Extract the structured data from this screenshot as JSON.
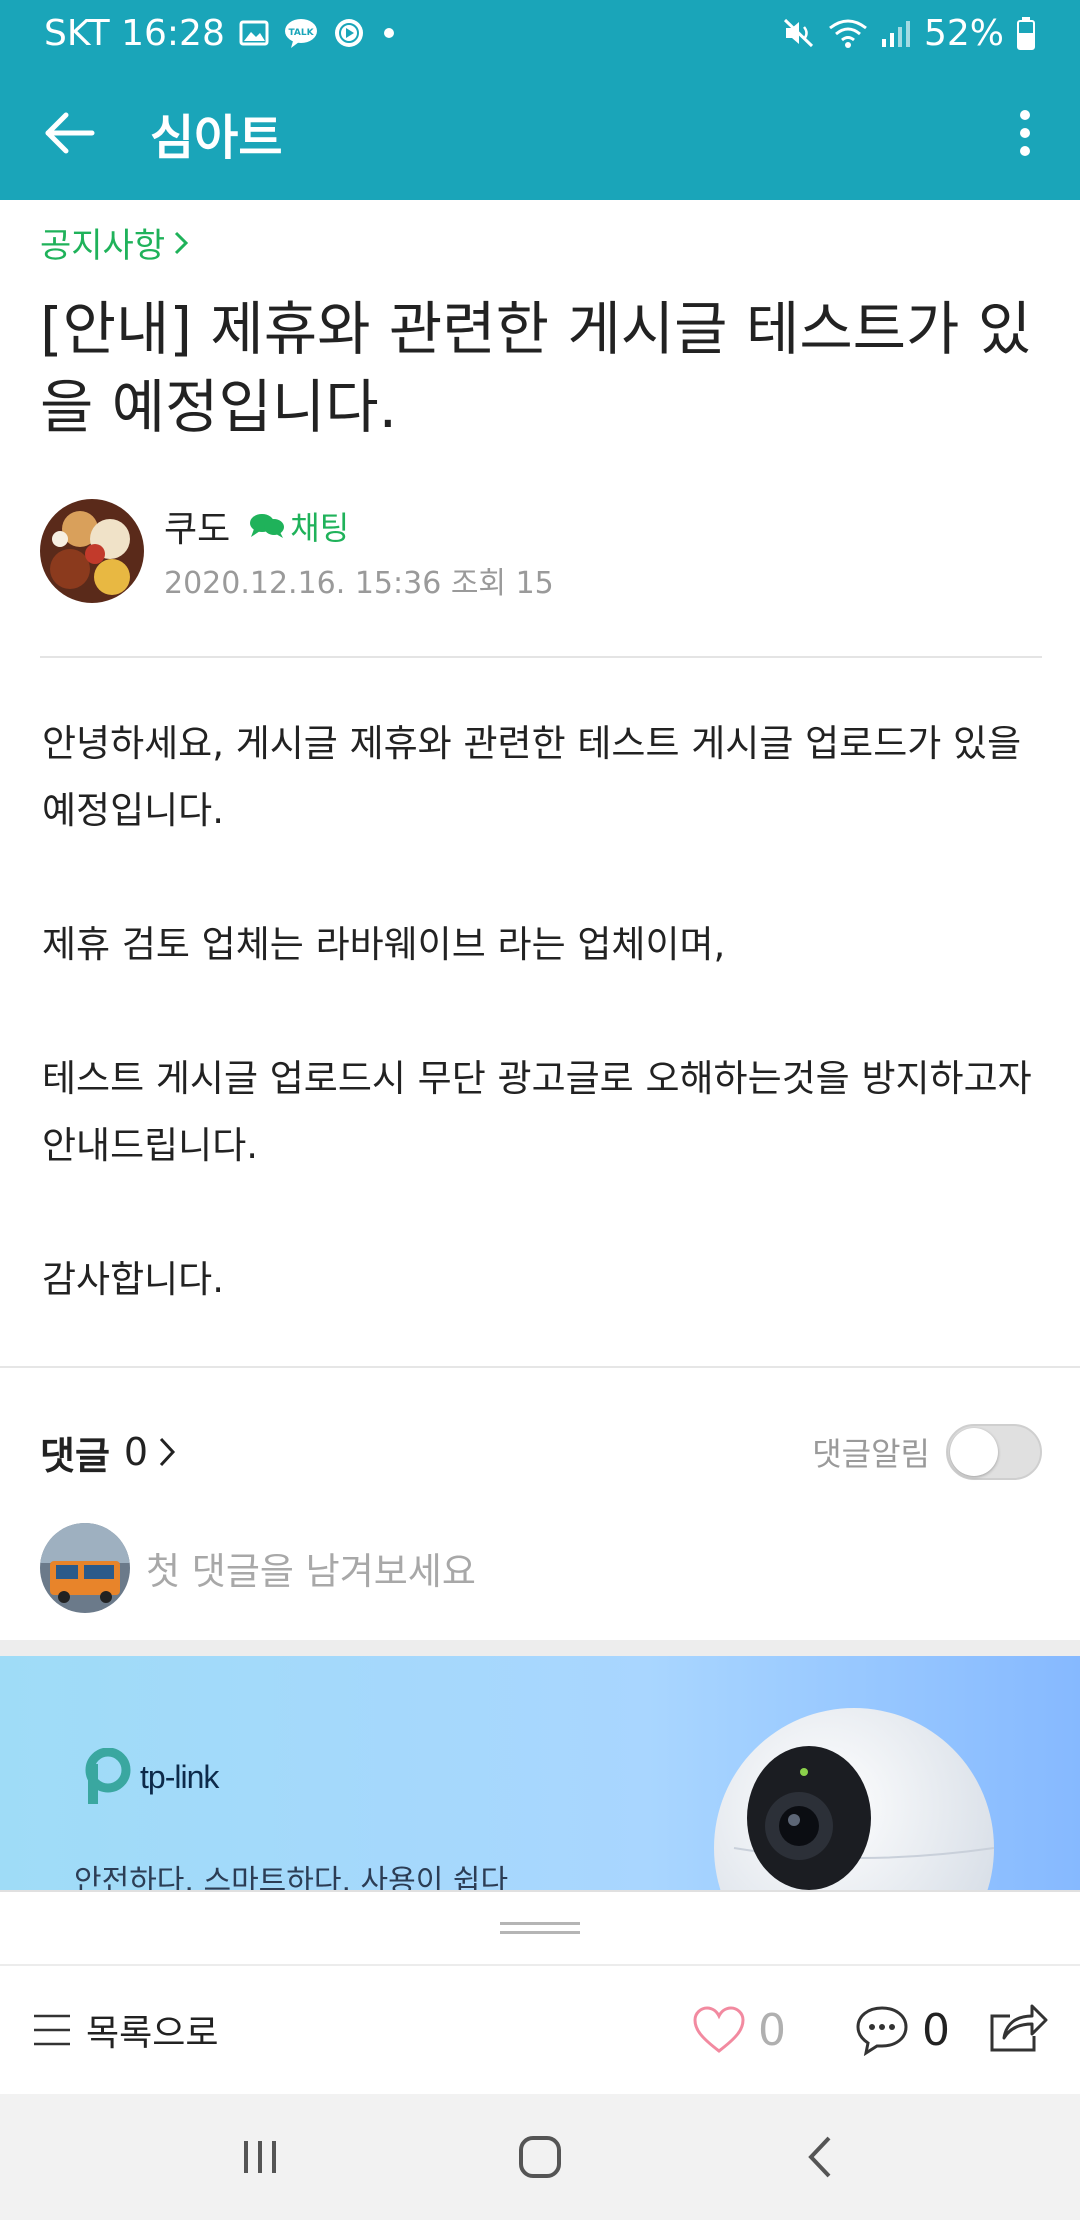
{
  "status_bar": {
    "carrier_time": "SKT 16:28",
    "battery": "52%"
  },
  "app_bar": {
    "title": "심아트"
  },
  "post": {
    "board": "공지사항",
    "title": "[안내] 제휴와 관련한 게시글 테스트가 있을 예정입니다.",
    "author": "쿠도",
    "chat_label": "채팅",
    "meta": "2020.12.16. 15:36 조회 15",
    "body": [
      "안녕하세요, 게시글 제휴와 관련한 테스트 게시글 업로드가 있을 예정입니다.",
      "제휴 검토 업체는 라바웨이브 라는 업체이며,",
      "테스트 게시글 업로드시 무단 광고글로 오해하는것을 방지하고자 안내드립니다.",
      "감사합니다."
    ]
  },
  "comments": {
    "label": "댓글",
    "count": "0",
    "notify_label": "댓글알림",
    "notify_on": false,
    "placeholder": "첫 댓글을 남겨보세요"
  },
  "ad": {
    "brand": "tp-link",
    "tagline": "안전하다. 스마트하다. 사용이 쉽다"
  },
  "toolbar": {
    "list_label": "목록으로",
    "like_count": "0",
    "comment_count": "0"
  },
  "colors": {
    "brand": "#1aa5b9",
    "green": "#1fb25a",
    "like": "#f28aa0"
  }
}
